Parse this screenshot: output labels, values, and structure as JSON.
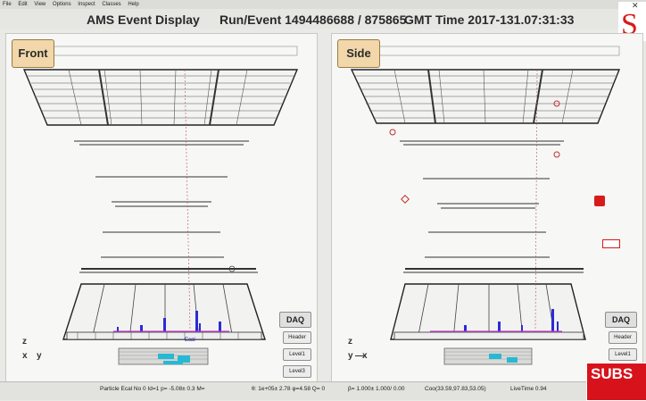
{
  "menubar": {
    "items": [
      "File",
      "Edit",
      "View",
      "Options",
      "Inspect",
      "Classes",
      "Help"
    ]
  },
  "window": {
    "app_title": "AMS Event Display",
    "run_event": "Run/Event 1494486688 / 875865",
    "gmt_time": "GMT Time 2017-131.07:31:33"
  },
  "panels": {
    "front": {
      "tab": "Front",
      "axis_z": "z",
      "axis_x": "x",
      "axis_y": "y",
      "ecal_label": "Ecal"
    },
    "side": {
      "tab": "Side",
      "axis_z": "z",
      "axis_y": "y",
      "axis_x": "x",
      "arrow": "—"
    }
  },
  "buttons": {
    "daq": "DAQ",
    "header": "Header",
    "level1": "Level1",
    "level3": "Level3"
  },
  "status": {
    "particle": "Particle Ecal No 0 Id=1 p=  -5.08±  0.3 M=",
    "coords": "θ: 1e+05± 2.78 φ=4.58 Q= 0",
    "beta": "β= 1.000±  1.000/ 0.00",
    "coo": "Coo(33.59,97.83,53.05)",
    "live": "LiveTime 0.94"
  },
  "overlay": {
    "subs_text": "SUBS",
    "logo_letter": "S"
  },
  "colors": {
    "accent": "#2b2bd6",
    "tab_bg": "#f1d7aa",
    "track": "#d04040",
    "subs_red": "#d8121b"
  }
}
